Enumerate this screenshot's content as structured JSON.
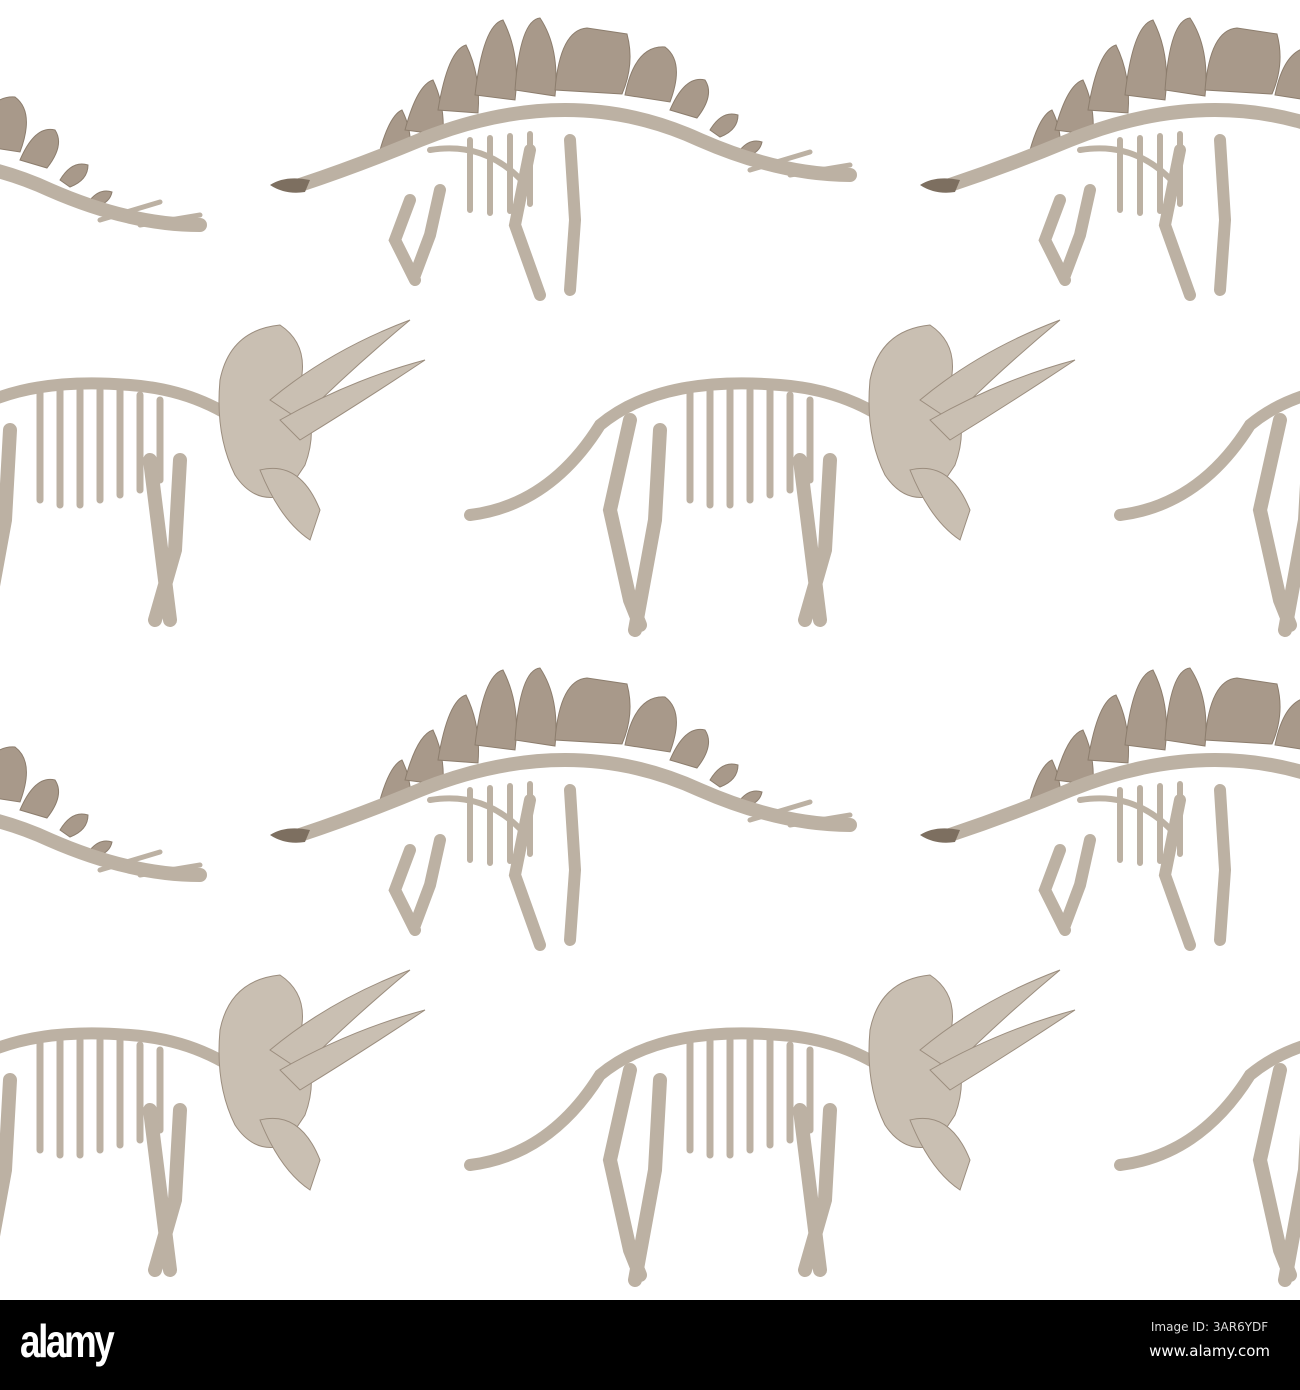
{
  "footer": {
    "logo": "alamy",
    "image_id": "Image ID: 3AR6YDF",
    "website": "www.alamy.com"
  },
  "colors": {
    "bone": "#bcb1a3",
    "plate": "#a8998a",
    "dark": "#7d6f60",
    "background": "#ffffff",
    "footer": "#000000"
  }
}
